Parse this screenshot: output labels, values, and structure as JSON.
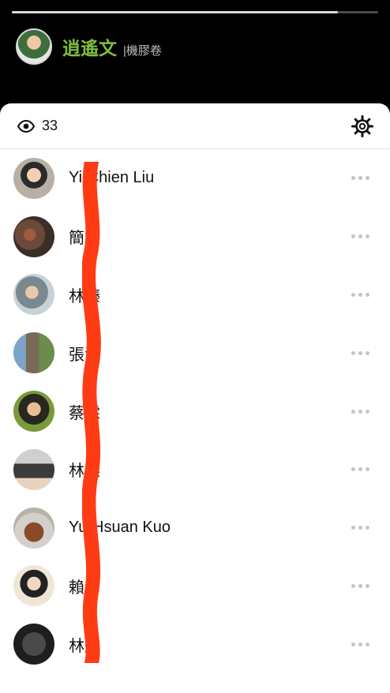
{
  "story": {
    "progress": 0.89,
    "author_name": "逍遙文",
    "author_subtitle": "|機膠卷"
  },
  "sheet": {
    "view_count": "33",
    "icons": {
      "views": "eye-icon",
      "settings": "gear-icon",
      "row_menu": "more-horizontal-icon"
    }
  },
  "viewers": [
    {
      "name": "Yi-Chien Liu"
    },
    {
      "name": "簡竣"
    },
    {
      "name": "林臻"
    },
    {
      "name": "張法"
    },
    {
      "name": "蔡霖"
    },
    {
      "name": "林傑"
    },
    {
      "name": "Yu-Hsuan Kuo"
    },
    {
      "name": "賴清"
    },
    {
      "name": "林航"
    }
  ],
  "colors": {
    "author_name": "#7fbf3d",
    "redaction_scribble": "#ff3b14"
  }
}
